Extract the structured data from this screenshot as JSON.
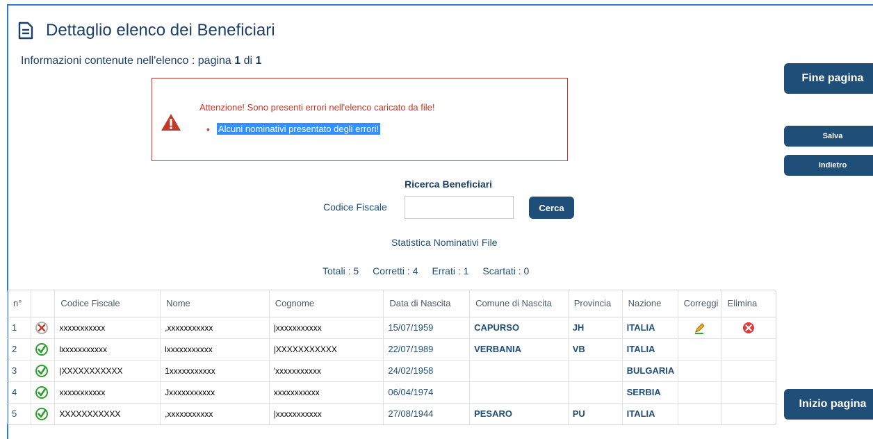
{
  "page": {
    "title": "Dettaglio elenco dei Beneficiari",
    "subtitle_prefix": "Informazioni contenute nell'elenco  :  pagina ",
    "page_current": "1",
    "page_sep": " di ",
    "page_total": "1"
  },
  "alert": {
    "message": "Attenzione! Sono presenti errori nell'elenco caricato da file!",
    "item": "Alcuni nominativi presentato degli errori!"
  },
  "side_buttons": {
    "fine_pagina": "Fine pagina",
    "salva": "Salva",
    "indietro": "Indietro",
    "inizio_pagina": "Inizio pagina"
  },
  "search": {
    "title": "Ricerca Beneficiari",
    "label": "Codice Fiscale",
    "value": "",
    "placeholder": "",
    "button": "Cerca"
  },
  "stats": {
    "title": "Statistica Nominativi File",
    "totali": "Totali : 5",
    "corretti": "Corretti : 4",
    "errati": "Errati :  1",
    "scartati": "Scartati :  0"
  },
  "table": {
    "headers": [
      "n°",
      "",
      "Codice Fiscale",
      "Nome",
      "Cognome",
      "Data di Nascita",
      "Comune di Nascita",
      "Provincia",
      "Nazione",
      "Correggi",
      "Elimina"
    ],
    "rows": [
      {
        "n": "1",
        "status": "error",
        "cf": "xxxxxxxxxxx",
        "nome": ",xxxxxxxxxxx",
        "cognome": "|xxxxxxxxxxx",
        "data": "15/07/1959",
        "comune": "CAPURSO",
        "provincia": "JH",
        "nazione": "ITALIA",
        "correggi": true,
        "elimina": true
      },
      {
        "n": "2",
        "status": "ok",
        "cf": "lxxxxxxxxxxx",
        "nome": "lxxxxxxxxxxx",
        "cognome": "|XXXXXXXXXXX",
        "data": "22/07/1989",
        "comune": "VERBANIA",
        "provincia": "VB",
        "nazione": "ITALIA",
        "correggi": false,
        "elimina": false
      },
      {
        "n": "3",
        "status": "ok",
        "cf": "|XXXXXXXXXXX",
        "nome": "1xxxxxxxxxxx",
        "cognome": "'xxxxxxxxxxx",
        "data": "24/02/1958",
        "comune": "",
        "provincia": "",
        "nazione": "BULGARIA",
        "correggi": false,
        "elimina": false
      },
      {
        "n": "4",
        "status": "ok",
        "cf": "xxxxxxxxxxx",
        "nome": "Jxxxxxxxxxxx",
        "cognome": "xxxxxxxxxxx",
        "data": "06/04/1974",
        "comune": "",
        "provincia": "",
        "nazione": "SERBIA",
        "correggi": false,
        "elimina": false
      },
      {
        "n": "5",
        "status": "ok",
        "cf": "XXXXXXXXXXX",
        "nome": ",xxxxxxxxxxx",
        "cognome": "|xxxxxxxxxxx",
        "data": "27/08/1944",
        "comune": "PESARO",
        "provincia": "PU",
        "nazione": "ITALIA",
        "correggi": false,
        "elimina": false
      }
    ]
  },
  "icons": {
    "title": "document-icon",
    "alert": "warning-triangle-icon",
    "status_ok": "check-circle-icon",
    "status_error": "x-circle-gray-icon",
    "correggi": "pencil-edit-icon",
    "elimina": "delete-red-circle-icon"
  },
  "colors": {
    "primary": "#1f4e79",
    "error": "#c0392b",
    "ok": "#2e9e2e",
    "highlight": "#3390ff"
  }
}
